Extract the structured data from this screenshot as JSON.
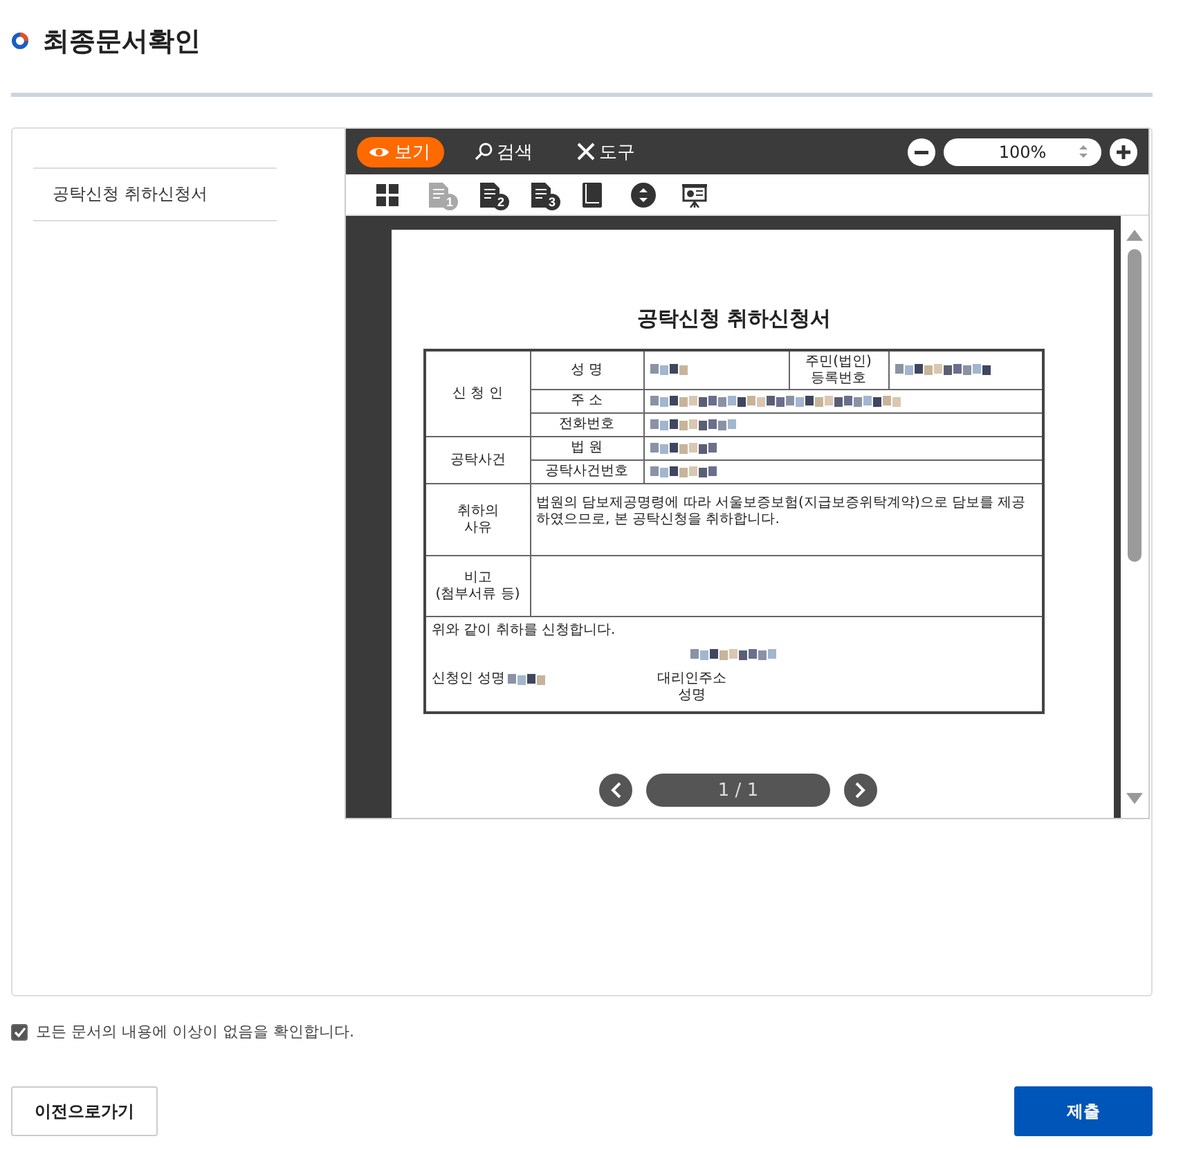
{
  "title": "최종문서확인",
  "sidebar": {
    "items": [
      {
        "label": "공탁신청 취하신청서",
        "selected": false
      }
    ]
  },
  "viewer": {
    "tabs": [
      {
        "kind": "view",
        "label": "보기",
        "selected": true
      },
      {
        "kind": "search",
        "label": "검색",
        "selected": false
      },
      {
        "kind": "tools",
        "label": "도구",
        "selected": false
      }
    ],
    "zoom": "100%",
    "tools": [
      {
        "kind": "grid",
        "disabled": false
      },
      {
        "kind": "list",
        "badge": "1",
        "disabled": true
      },
      {
        "kind": "list",
        "badge": "2",
        "disabled": false
      },
      {
        "kind": "list",
        "badge": "3",
        "disabled": false
      },
      {
        "kind": "book",
        "disabled": false
      },
      {
        "kind": "updown",
        "disabled": false
      },
      {
        "kind": "presentation",
        "disabled": false
      }
    ],
    "document": {
      "title": "공탁신청 취하신청서",
      "applicant_label": "신 청 인",
      "name_label": "성 명",
      "id_label": "주민(법인)\n등록번호",
      "address_label": "주 소",
      "phone_label": "전화번호",
      "case_label": "공탁사건",
      "court_label": "법 원",
      "case_no_label": "공탁사건번호",
      "reason_label": "취하의\n사유",
      "reason_text": "법원의 담보제공명령에 따라 서울보증보험(지급보증위탁계약)으로 담보를 제공하였으므로, 본 공탁신청을 취하합니다.",
      "remarks_label": "비고\n(첨부서류 등)",
      "statement": "위와 같이 취하를 신청합니다.",
      "signer_label": "신청인 성명",
      "agent_label": "대리인주소\n성명"
    },
    "pager": "1 / 1"
  },
  "confirm": {
    "label": "모든 문서의 내용에 이상이 없음을 확인합니다.",
    "checked": true
  },
  "buttons": [
    {
      "kind": "secondary",
      "label": "이전으로가기"
    },
    {
      "kind": "primary",
      "label": "제출"
    }
  ]
}
